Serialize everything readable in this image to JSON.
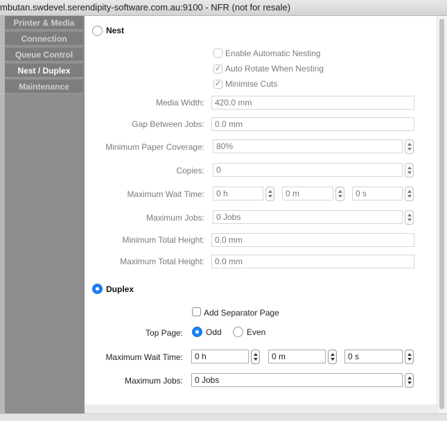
{
  "window": {
    "title": "mbutan.swdevel.serendipity-software.com.au:9100 - NFR (not for resale)"
  },
  "sidebar": {
    "items": [
      {
        "label": "Printer & Media",
        "active": false
      },
      {
        "label": "Connection",
        "active": false
      },
      {
        "label": "Queue Control",
        "active": false
      },
      {
        "label": "Nest / Duplex",
        "active": true
      },
      {
        "label": "Maintenance",
        "active": false
      }
    ]
  },
  "nest": {
    "radio_label": "Nest",
    "selected": false,
    "enable_automatic_nesting": {
      "label": "Enable Automatic Nesting",
      "checked": false
    },
    "auto_rotate": {
      "label": "Auto Rotate When Nesting",
      "checked": true
    },
    "minimise_cuts": {
      "label": "Minimise Cuts",
      "checked": true
    },
    "media_width": {
      "label": "Media Width:",
      "value": "420.0 mm"
    },
    "gap_between_jobs": {
      "label": "Gap Between Jobs:",
      "value": "0.0 mm"
    },
    "min_paper_coverage": {
      "label": "Minimum Paper Coverage:",
      "value": "80%"
    },
    "copies": {
      "label": "Copies:",
      "value": "0"
    },
    "max_wait_time": {
      "label": "Maximum Wait Time:",
      "hours": "0 h",
      "minutes": "0 m",
      "seconds": "0 s"
    },
    "max_jobs": {
      "label": "Maximum Jobs:",
      "value": "0 Jobs"
    },
    "min_total_height": {
      "label": "Minimum Total Height:",
      "value": "0.0 mm"
    },
    "max_total_height": {
      "label": "Maximum Total Height:",
      "value": "0.0 mm"
    }
  },
  "duplex": {
    "radio_label": "Duplex",
    "selected": true,
    "add_separator_page": {
      "label": "Add Separator Page",
      "checked": false
    },
    "top_page": {
      "label": "Top Page:",
      "odd_label": "Odd",
      "even_label": "Even",
      "selected": "Odd"
    },
    "max_wait_time": {
      "label": "Maximum Wait Time:",
      "hours": "0 h",
      "minutes": "0 m",
      "seconds": "0 s"
    },
    "max_jobs": {
      "label": "Maximum Jobs:",
      "value": "0 Jobs"
    }
  },
  "colors": {
    "accent": "#1a82f5",
    "sidebar_bg": "#8d8d8d",
    "panel_bg": "#ffffff"
  }
}
